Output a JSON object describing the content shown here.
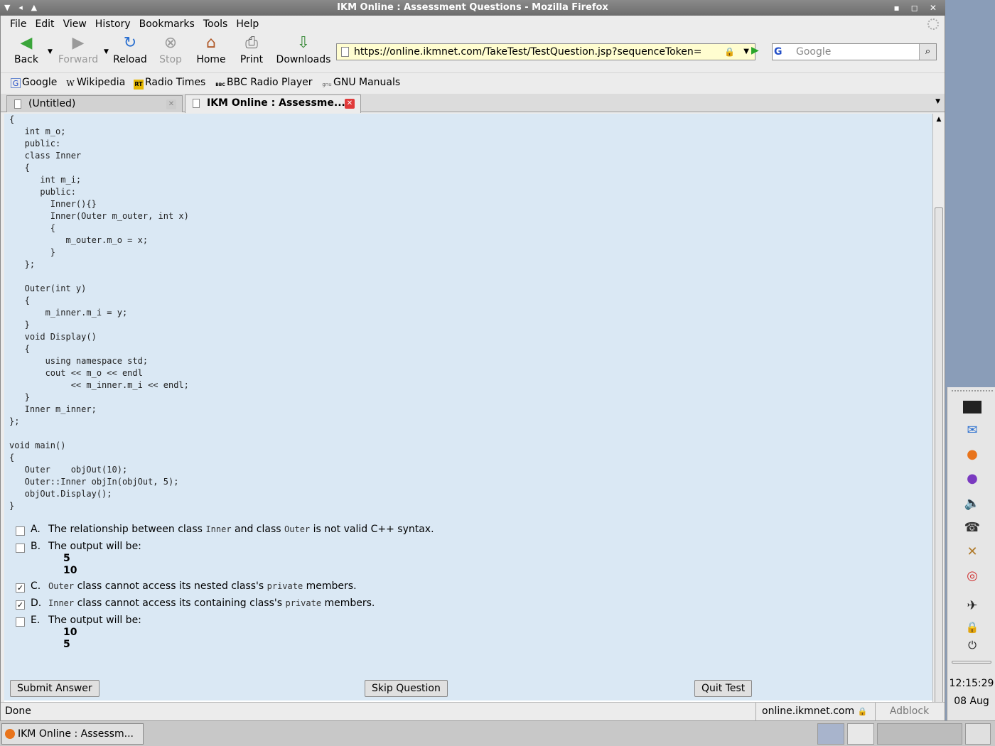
{
  "window": {
    "title": "IKM Online : Assessment Questions - Mozilla Firefox"
  },
  "menu": [
    "File",
    "Edit",
    "View",
    "History",
    "Bookmarks",
    "Tools",
    "Help"
  ],
  "nav": {
    "back": "Back",
    "forward": "Forward",
    "reload": "Reload",
    "stop": "Stop",
    "home": "Home",
    "print": "Print",
    "downloads": "Downloads"
  },
  "urlbar": {
    "url": "https://online.ikmnet.com/TakeTest/TestQuestion.jsp?sequenceToken="
  },
  "search": {
    "placeholder": "Google",
    "engine": "G"
  },
  "bookmarks": [
    {
      "label": "Google",
      "icon": "G"
    },
    {
      "label": "Wikipedia",
      "icon": "W"
    },
    {
      "label": "Radio Times",
      "icon": "RT"
    },
    {
      "label": "BBC Radio Player",
      "icon": "BBC"
    },
    {
      "label": "GNU Manuals",
      "icon": "gnu"
    }
  ],
  "tabs": [
    {
      "label": "(Untitled)"
    },
    {
      "label": "IKM Online : Assessme..."
    }
  ],
  "code": "{\n   int m_o;\n   public:\n   class Inner\n   {\n      int m_i;\n      public:\n        Inner(){}\n        Inner(Outer m_outer, int x)\n        {\n           m_outer.m_o = x;\n        }\n   };\n\n   Outer(int y)\n   {\n       m_inner.m_i = y;\n   }\n   void Display()\n   {\n       using namespace std;\n       cout << m_o << endl\n            << m_inner.m_i << endl;\n   }\n   Inner m_inner;\n};\n\nvoid main()\n{\n   Outer    objOut(10);\n   Outer::Inner objIn(objOut, 5);\n   objOut.Display();\n}",
  "answers": {
    "a": {
      "letter": "A.",
      "t1": "The relationship between class ",
      "c1": "Inner",
      "t2": " and class ",
      "c2": "Outer",
      "t3": " is not valid C++ syntax.",
      "checked": false
    },
    "b": {
      "letter": "B.",
      "t1": "The output will be:",
      "l1": "5",
      "l2": "10",
      "checked": false
    },
    "c": {
      "letter": "C.",
      "c1": "Outer",
      "t1": " class cannot access its nested class's ",
      "c2": "private",
      "t2": " members.",
      "checked": true
    },
    "d": {
      "letter": "D.",
      "c1": "Inner",
      "t1": " class cannot access its containing class's ",
      "c2": "private",
      "t2": " members.",
      "checked": true
    },
    "e": {
      "letter": "E.",
      "t1": "The output will be:",
      "l1": "10",
      "l2": "5",
      "checked": false
    }
  },
  "buttons": {
    "submit": "Submit Answer",
    "skip": "Skip Question",
    "quit": "Quit Test"
  },
  "status": {
    "text": "Done",
    "host": "online.ikmnet.com",
    "adblock": "Adblock"
  },
  "taskbar": {
    "task": "IKM Online : Assessm..."
  },
  "clock": {
    "time": "12:15:29",
    "date": "08 Aug"
  },
  "colors": {
    "content_bg": "#dae8f4",
    "close_red": "#e03a3a",
    "url_bg": "#fffdd0"
  }
}
